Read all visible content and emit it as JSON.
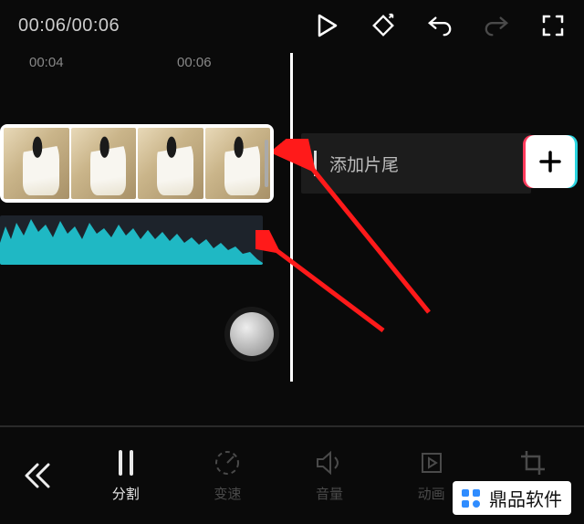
{
  "header": {
    "time_current": "00:06",
    "time_total": "00:06",
    "time_combined": "00:06/00:06"
  },
  "ruler": {
    "ticks": [
      {
        "pos": 32,
        "label": "00:04"
      },
      {
        "pos": 194,
        "label": "00:06"
      }
    ]
  },
  "timeline": {
    "add_ending_label": "添加片尾"
  },
  "toolbar": {
    "items": [
      {
        "key": "split",
        "label": "分割",
        "active": true
      },
      {
        "key": "speed",
        "label": "变速",
        "active": false
      },
      {
        "key": "volume",
        "label": "音量",
        "active": false
      },
      {
        "key": "anim",
        "label": "动画",
        "active": false
      },
      {
        "key": "crop",
        "label": "裁剪",
        "active": false
      }
    ]
  },
  "watermark": {
    "brand": "鼎品软件"
  },
  "icons": {
    "play": "play-icon",
    "keyframe": "keyframe-diamond-icon",
    "undo": "undo-icon",
    "redo": "redo-icon",
    "fullscreen": "fullscreen-icon",
    "plus": "plus-icon",
    "back": "chevrons-left-icon"
  }
}
